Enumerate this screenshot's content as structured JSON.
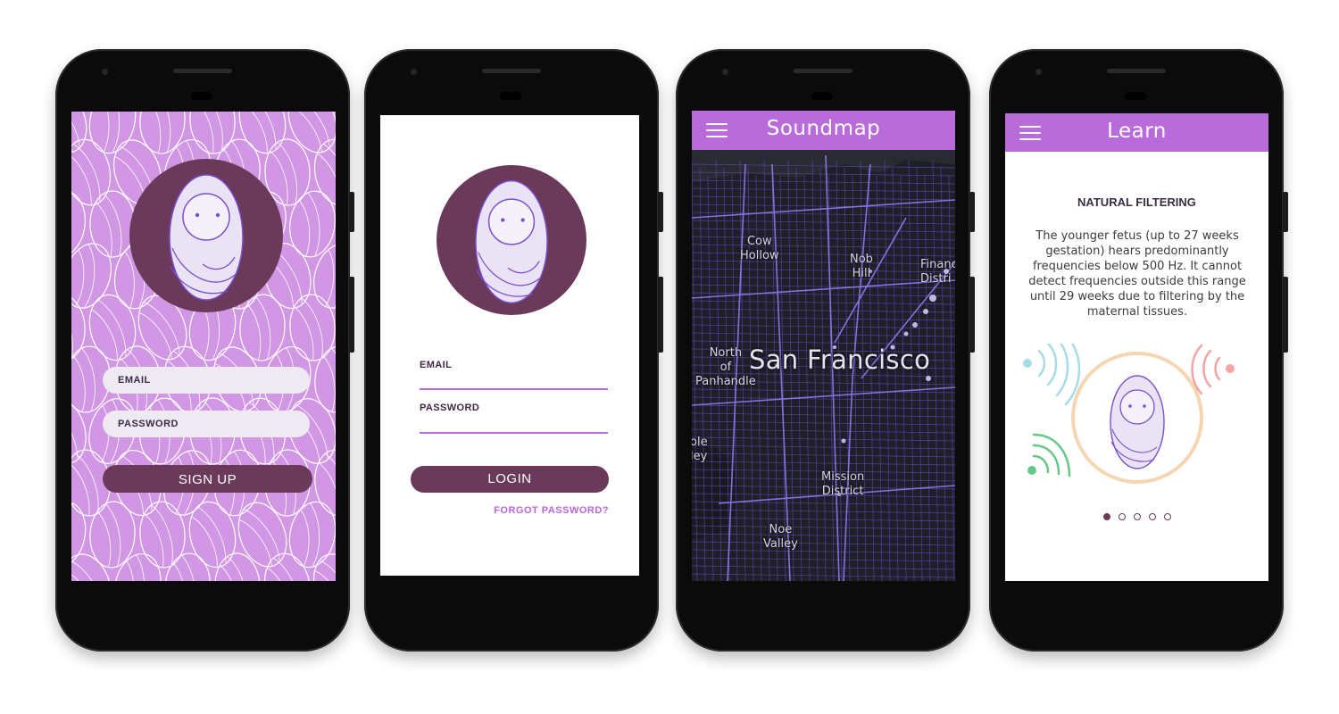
{
  "screens": {
    "signup": {
      "email_label": "EMAIL",
      "password_label": "PASSWORD",
      "signup_button": "SIGN UP"
    },
    "login": {
      "email_label": "EMAIL",
      "password_label": "PASSWORD",
      "login_button": "LOGIN",
      "forgot_link": "FORGOT PASSWORD?"
    },
    "soundmap": {
      "title": "Soundmap",
      "city": "San Francisco",
      "neighborhoods": {
        "cow_hollow": "Cow\nHollow",
        "nob_hill": "Nob\nHill",
        "financial": "Financ\nDistri",
        "north_panhandle": "North\nof\nPanhandle",
        "mission": "Mission\nDistrict",
        "noe_valley": "Noe\nValley",
        "cole_valley": "ole\nley"
      }
    },
    "learn": {
      "title": "Learn",
      "heading": "NATURAL FILTERING",
      "body": "The younger fetus (up to 27 weeks gestation) hears predominantly frequencies below 500 Hz. It cannot detect frequencies outside this range until 29 weeks due to filtering by the maternal tissues.",
      "pages_total": 5,
      "current_page": 1
    }
  },
  "colors": {
    "brand_purple": "#b96bd9",
    "plum": "#6b3a5a",
    "pattern_bg": "#d197e5",
    "baby_fill": "#e9e3f5",
    "baby_stroke": "#7a4fcf"
  },
  "icons": {
    "menu": "hamburger-menu-icon",
    "baby": "swaddled-baby-icon"
  }
}
